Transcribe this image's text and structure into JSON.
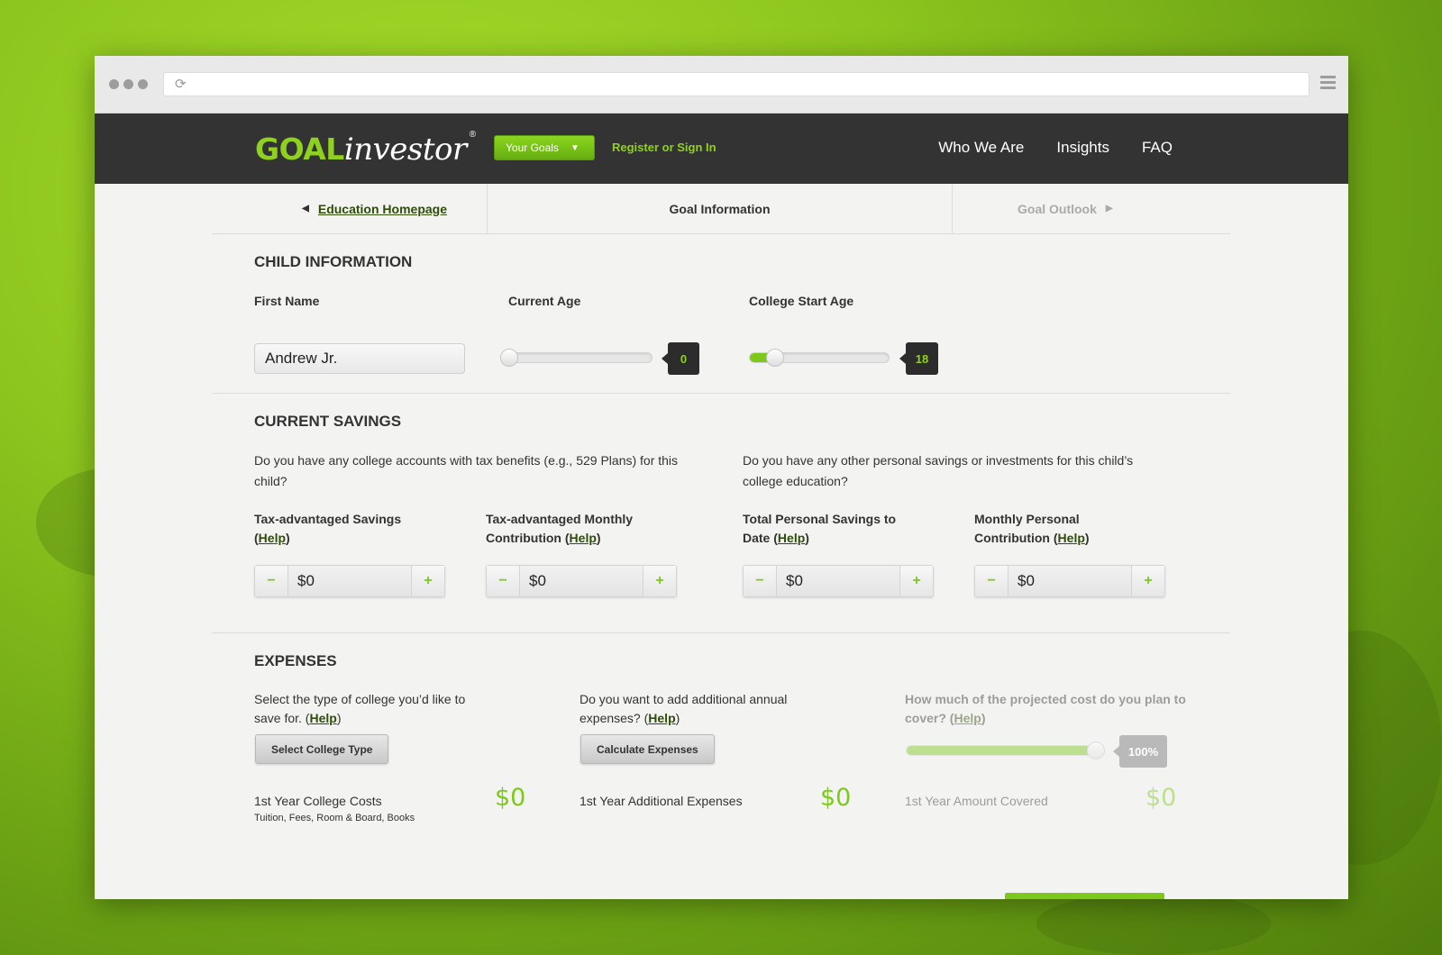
{
  "browser": {
    "url": ""
  },
  "nav": {
    "logo_main": "GOAL",
    "logo_sub": "investor",
    "logo_reg": "®",
    "goals_button": "Your Goals",
    "register": "Register or Sign In",
    "menu": [
      "Who We Are",
      "Insights",
      "FAQ"
    ]
  },
  "steps": {
    "back": "Education Homepage",
    "current": "Goal Information",
    "next": "Goal Outlook"
  },
  "child": {
    "title": "CHILD INFORMATION",
    "first_name_label": "First Name",
    "first_name_value": "Andrew Jr.",
    "current_age_label": "Current Age",
    "current_age_value": "0",
    "current_age_fraction": 0,
    "college_age_label": "College Start Age",
    "college_age_value": "18",
    "college_age_fraction": 0.18
  },
  "savings": {
    "title": "CURRENT SAVINGS",
    "question_left": "Do you have any college accounts with tax benefits (e.g., 529 Plans) for this child?",
    "question_right": "Do you have any other personal savings or investments for this child’s college education?",
    "help": "Help",
    "fields": [
      {
        "label": "Tax-advantaged Savings",
        "value": "$0"
      },
      {
        "label": "Tax-advantaged Monthly Contribution",
        "value": "$0"
      },
      {
        "label": "Total Personal Savings to Date",
        "value": "$0"
      },
      {
        "label": "Monthly Personal Contribution",
        "value": "$0"
      }
    ],
    "minus": "−",
    "plus": "+"
  },
  "expenses": {
    "title": "EXPENSES",
    "q1": "Select the type of college you’d like to save for.",
    "q2": "Do you want to add additional annual expenses?",
    "q3": "How much of the projected cost do you plan to cover?",
    "help": "Help",
    "btn1": "Select College Type",
    "btn2": "Calculate Expenses",
    "cover_value": "100%",
    "cover_fraction": 1.0,
    "r1_label": "1st Year College Costs",
    "r1_sub": "Tuition, Fees, Room & Board, Books",
    "r1_value": "$0",
    "r2_label": "1st Year Additional Expenses",
    "r2_value": "$0",
    "r3_label": "1st Year Amount Covered",
    "r3_value": "$0"
  }
}
